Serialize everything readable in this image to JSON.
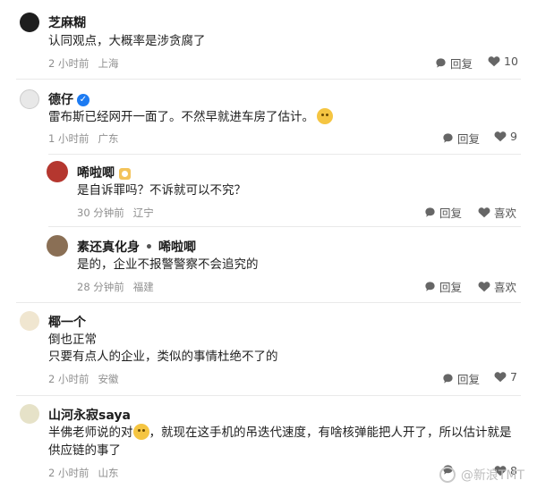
{
  "comments": [
    {
      "username": "芝麻糊",
      "text": "认同观点，大概率是涉贪腐了",
      "time": "2 小时前",
      "location": "上海",
      "reply_label": "回复",
      "likes": "10"
    },
    {
      "username": "德仔",
      "text": "雷布斯已经网开一面了。不然早就进车房了估计。",
      "time": "1 小时前",
      "location": "广东",
      "reply_label": "回复",
      "likes": "9"
    },
    {
      "username": "唏啦唧",
      "text": "是自诉罪吗？不诉就可以不究？",
      "time": "30 分钟前",
      "location": "辽宁",
      "reply_label": "回复",
      "like_label": "喜欢"
    },
    {
      "username": "素还真化身",
      "reply_sep": "•",
      "reply_to": "唏啦唧",
      "text": "是的，企业不报警警察不会追究的",
      "time": "28 分钟前",
      "location": "福建",
      "reply_label": "回复",
      "like_label": "喜欢"
    },
    {
      "username": "椰一个",
      "text_line1": "倒也正常",
      "text_line2": "只要有点人的企业，类似的事情杜绝不了的",
      "time": "2 小时前",
      "location": "安徽",
      "reply_label": "回复",
      "likes": "7"
    },
    {
      "username": "山河永寂saya",
      "text_line1a": "半佛老师说的对",
      "text_line1b": "，就现在这手机的吊迭代速度，有啥核弹能把人开了，所以估计就是",
      "text_line2": "供应链的事了",
      "time": "2 小时前",
      "location": "山东",
      "likes": "8"
    }
  ],
  "watermark": "@新浪TMT",
  "colors": {
    "verified_badge": "#1d7bf2",
    "level_badge": "#f3c35a",
    "meta_text": "#8f8f8f"
  }
}
